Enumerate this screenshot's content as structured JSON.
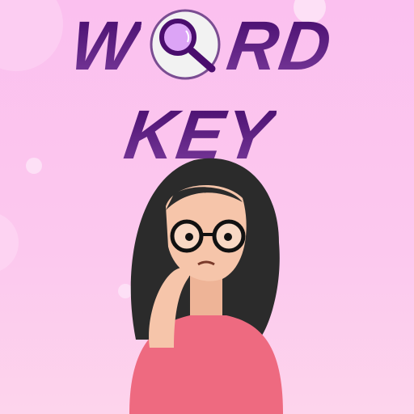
{
  "logo": {
    "word_left": "W",
    "word_right": "RD",
    "line2": "KEY"
  },
  "icons": [
    "magnifier-icon"
  ],
  "colors": {
    "background": "#fbc0ef",
    "title": "#5a1a82",
    "lens": "#dca4f6",
    "shirt": "#ee6a80",
    "hair": "#2b2b2b",
    "skin": "#f6c5aa"
  }
}
